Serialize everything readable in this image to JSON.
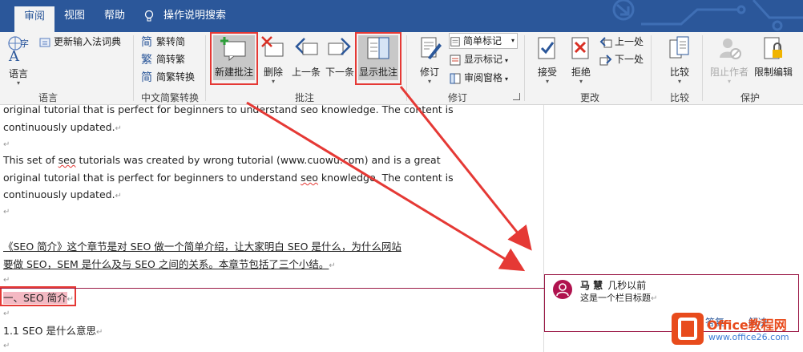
{
  "tabs": {
    "review": "审阅",
    "view": "视图",
    "help": "帮助",
    "tell_me": "操作说明搜索"
  },
  "ribbon": {
    "language": {
      "language_btn": "语言",
      "reenter_ime": "更新输入法词典",
      "group": "语言"
    },
    "chinese": {
      "to_simplified": "繁转简",
      "to_traditional": "简转繁",
      "convert": "简繁转换",
      "group": "中文简繁转换"
    },
    "comments": {
      "new_comment": "新建批注",
      "delete": "删除",
      "previous": "上一条",
      "next": "下一条",
      "show_comments": "显示批注",
      "group": "批注"
    },
    "tracking": {
      "track_changes": "修订",
      "simple_markup": "简单标记",
      "show_markup": "显示标记",
      "reviewing_pane": "审阅窗格",
      "group": "修订"
    },
    "changes": {
      "accept": "接受",
      "reject": "拒绝",
      "previous": "上一处",
      "next": "下一处",
      "group": "更改"
    },
    "compare": {
      "compare": "比较",
      "group": "比较"
    },
    "protect": {
      "block_authors": "阻止作者",
      "restrict_editing": "限制编辑",
      "group": "保护"
    }
  },
  "document": {
    "p1_line1": "original tutorial that is perfect for beginners to understand seo knowledge. The content is",
    "p1_line2": "continuously updated.",
    "p2_line1_a": "This set of ",
    "p2_line1_seo": "seo",
    "p2_line1_b": " tutorials was created by wrong tutorial (www.cuowu.com) and is a great",
    "p3_line1_a": "original tutorial that is perfect for beginners to understand ",
    "p3_line1_seo": "seo",
    "p3_line1_b": " knowledge. The content is",
    "p3_line2": "continuously updated.",
    "p4_line1": "《SEO 简介》这个章节是对 SEO 做一个简单介绍，让大家明白 SEO 是什么，为什么网站",
    "p4_line2": "要做 SEO，SEM 是什么及与 SEO 之间的关系。本章节包括了三个小结。",
    "heading1": "一、SEO 简介",
    "heading2": "1.1 SEO 是什么意思",
    "para_mark": "↵"
  },
  "comment": {
    "author": "马 慧",
    "time": "几秒以前",
    "text": "这是一个栏目标题",
    "reply": "答复",
    "resolve": "解决"
  },
  "watermark": {
    "title": "Office教程网",
    "url": "www.office26.com"
  },
  "colors": {
    "ribbon_tab_bar": "#2b579a",
    "highlight_box": "#e53935",
    "comment_accent": "#9b1a47",
    "commented_text_bg": "#f4b9c3",
    "arrow": "#e53935"
  }
}
